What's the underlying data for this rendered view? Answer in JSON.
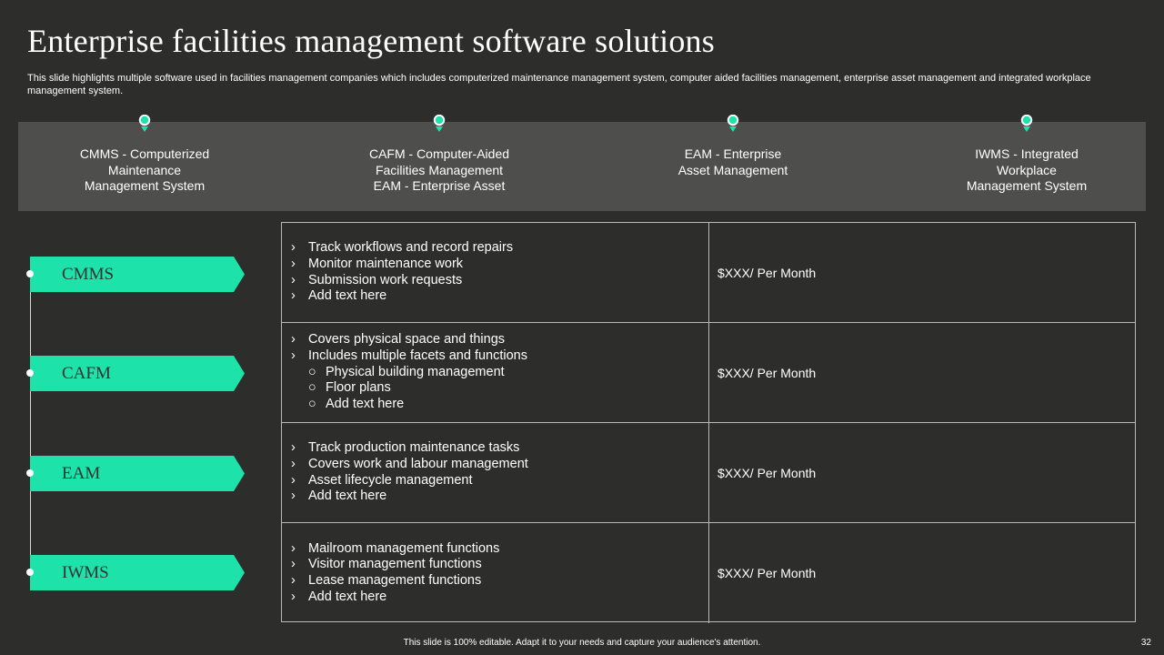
{
  "title": "Enterprise facilities management software solutions",
  "subtitle": "This slide highlights multiple software used in facilities management companies which includes computerized maintenance management system, computer aided facilities management, enterprise asset management and integrated workplace management system.",
  "colors": {
    "accent": "#1de2aa",
    "background": "#2d2d2b",
    "band": "#4e4e4c",
    "border": "#b9b9b9"
  },
  "top_band": [
    {
      "label": "CMMS - Computerized\nMaintenance\nManagement System",
      "icon": "map-pin-icon"
    },
    {
      "label": "CAFM - Computer-Aided\nFacilities Management\nEAM - Enterprise Asset",
      "icon": "map-pin-icon"
    },
    {
      "label": "EAM - Enterprise\nAsset Management",
      "icon": "map-pin-icon"
    },
    {
      "label": "IWMS - Integrated\nWorkplace\nManagement System",
      "icon": "map-pin-icon"
    }
  ],
  "tags": [
    "CMMS",
    "CAFM",
    "EAM",
    "IWMS"
  ],
  "bullet_marker": "›",
  "sub_marker": "○",
  "rows": [
    {
      "bullets": [
        {
          "text": "Track workflows and record repairs",
          "sub": false
        },
        {
          "text": "Monitor maintenance work",
          "sub": false
        },
        {
          "text": "Submission work requests",
          "sub": false
        },
        {
          "text": "Add text here",
          "sub": false
        }
      ],
      "price": "$XXX/  Per Month"
    },
    {
      "bullets": [
        {
          "text": "Covers physical space and things",
          "sub": false
        },
        {
          "text": "Includes multiple facets and functions",
          "sub": false
        },
        {
          "text": "Physical building management",
          "sub": true
        },
        {
          "text": "Floor plans",
          "sub": true
        },
        {
          "text": "Add text here",
          "sub": true
        }
      ],
      "price": "$XXX/  Per Month"
    },
    {
      "bullets": [
        {
          "text": "Track production maintenance tasks",
          "sub": false
        },
        {
          "text": "Covers work and labour management",
          "sub": false
        },
        {
          "text": "Asset lifecycle management",
          "sub": false
        },
        {
          "text": "Add text here",
          "sub": false
        }
      ],
      "price": "$XXX/  Per Month"
    },
    {
      "bullets": [
        {
          "text": "Mailroom management functions",
          "sub": false
        },
        {
          "text": "Visitor management functions",
          "sub": false
        },
        {
          "text": "Lease management functions",
          "sub": false
        },
        {
          "text": "Add text here",
          "sub": false
        }
      ],
      "price": "$XXX/  Per Month"
    }
  ],
  "footer": "This slide is 100% editable.  Adapt it to your needs and capture your audience's attention.",
  "page_number": "32"
}
